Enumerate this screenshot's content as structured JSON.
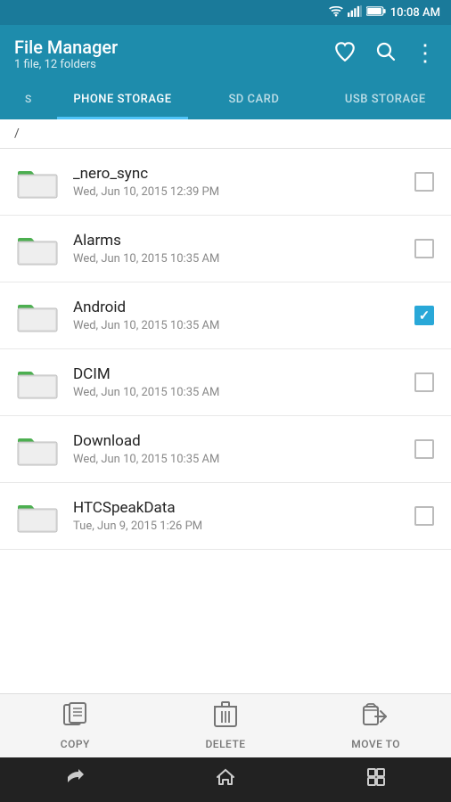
{
  "statusBar": {
    "time": "10:08 AM",
    "icons": [
      "wifi",
      "signal",
      "battery"
    ]
  },
  "header": {
    "title": "File Manager",
    "subtitle": "1 file, 12 folders",
    "heartIcon": "♥",
    "searchIcon": "🔍",
    "moreIcon": "⋮"
  },
  "tabs": [
    {
      "id": "s",
      "label": "S",
      "active": false,
      "short": true
    },
    {
      "id": "phone",
      "label": "PHONE STORAGE",
      "active": true
    },
    {
      "id": "sd",
      "label": "SD CARD",
      "active": false
    },
    {
      "id": "usb",
      "label": "USB STORAGE",
      "active": false
    }
  ],
  "breadcrumb": "/",
  "files": [
    {
      "name": "_nero_sync",
      "date": "Wed, Jun 10, 2015 12:39 PM",
      "checked": false
    },
    {
      "name": "Alarms",
      "date": "Wed, Jun 10, 2015 10:35 AM",
      "checked": false
    },
    {
      "name": "Android",
      "date": "Wed, Jun 10, 2015 10:35 AM",
      "checked": true
    },
    {
      "name": "DCIM",
      "date": "Wed, Jun 10, 2015 10:35 AM",
      "checked": false
    },
    {
      "name": "Download",
      "date": "Wed, Jun 10, 2015 10:35 AM",
      "checked": false
    },
    {
      "name": "HTCSpeakData",
      "date": "Tue, Jun 9, 2015 1:26 PM",
      "checked": false
    }
  ],
  "toolbar": {
    "copy": "COPY",
    "delete": "DELETE",
    "moveTo": "MOVE TO"
  },
  "navBar": {
    "back": "↩",
    "home": "⌂",
    "recent": "▣"
  }
}
